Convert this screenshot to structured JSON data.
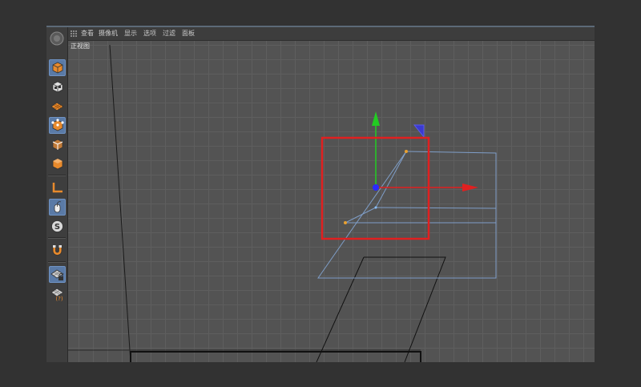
{
  "menu": {
    "items": [
      "查看",
      "摄像机",
      "显示",
      "选项",
      "过滤",
      "面板"
    ]
  },
  "viewport": {
    "label": "正视图"
  },
  "sidebar": {
    "tools": [
      {
        "icon": "model-mode-icon",
        "active": true
      },
      {
        "icon": "object-mode-icon",
        "active": false
      },
      {
        "icon": "texture-mode-icon",
        "active": false
      },
      {
        "icon": "points-mode-icon",
        "active": true
      },
      {
        "icon": "edges-mode-icon",
        "active": false
      },
      {
        "icon": "polygons-mode-icon",
        "active": false
      },
      {
        "icon": "axis-mode-icon",
        "active": false
      },
      {
        "icon": "tweak-mode-icon",
        "active": false
      },
      {
        "icon": "solo-mode-icon",
        "active": false
      },
      {
        "icon": "snap-magnet-icon",
        "active": false
      },
      {
        "icon": "workplane-lock-icon",
        "active": false
      },
      {
        "icon": "workplane-mode-icon",
        "active": false
      }
    ]
  },
  "colors": {
    "selection_highlight": "#e02020",
    "y_axis": "#22cc22",
    "x_axis": "#e02020",
    "z_handle": "#3a3ad0",
    "mesh_wire": "#7f9ec8",
    "point": "#e8a030"
  }
}
